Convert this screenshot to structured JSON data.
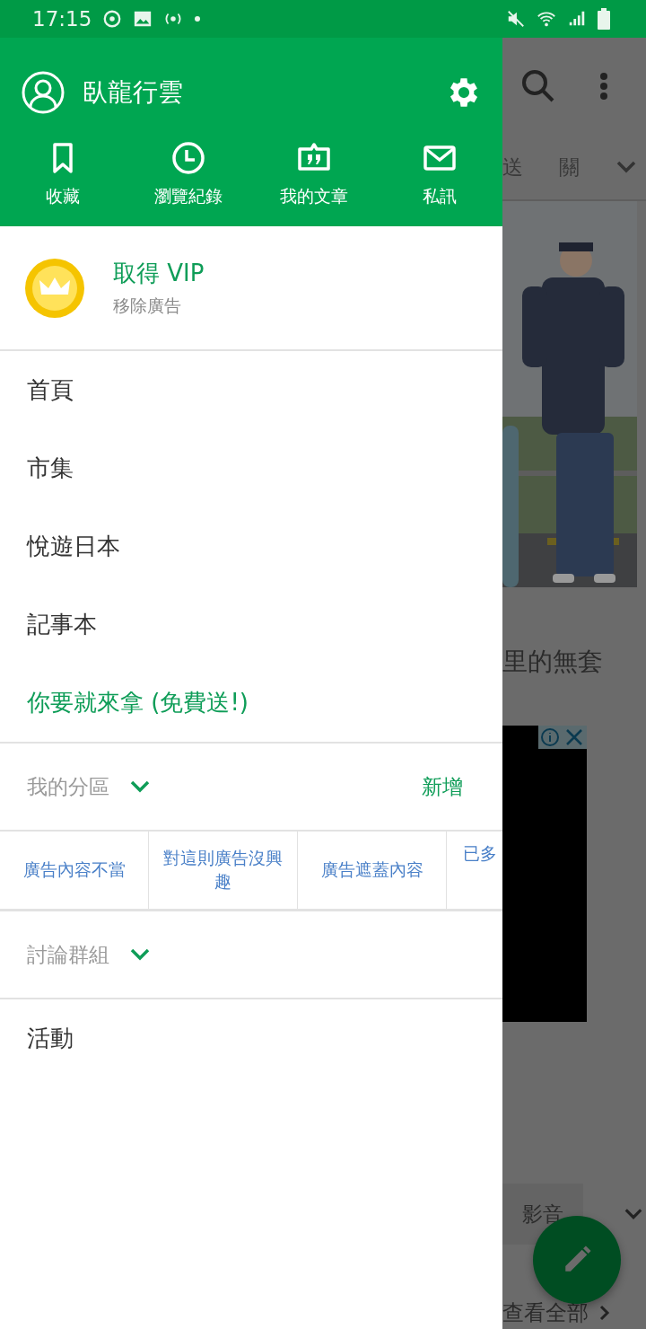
{
  "status_bar": {
    "time": "17:15"
  },
  "drawer": {
    "user_name": "臥龍行雲",
    "shortcuts": [
      {
        "label": "收藏"
      },
      {
        "label": "瀏覽紀錄"
      },
      {
        "label": "我的文章"
      },
      {
        "label": "私訊"
      }
    ],
    "vip": {
      "title": "取得 VIP",
      "subtitle": "移除廣告"
    },
    "menu": [
      {
        "label": "首頁",
        "kind": "normal"
      },
      {
        "label": "市集",
        "kind": "normal"
      },
      {
        "label": "悅遊日本",
        "kind": "normal"
      },
      {
        "label": "記事本",
        "kind": "normal"
      },
      {
        "label": "你要就來拿 (免費送!)",
        "kind": "highlight"
      }
    ],
    "my_sections": {
      "label": "我的分區",
      "action": "新增"
    },
    "ad_feedback": [
      "廣告內容不當",
      "對這則廣告沒興趣",
      "廣告遮蓋內容",
      "已多"
    ],
    "groups": {
      "label": "討論群組"
    },
    "bottom_menu": [
      {
        "label": "活動"
      }
    ]
  },
  "background": {
    "tabs": [
      "送",
      "關"
    ],
    "headline": "里的無套",
    "chip": "影音",
    "see_all": "查看全部"
  }
}
